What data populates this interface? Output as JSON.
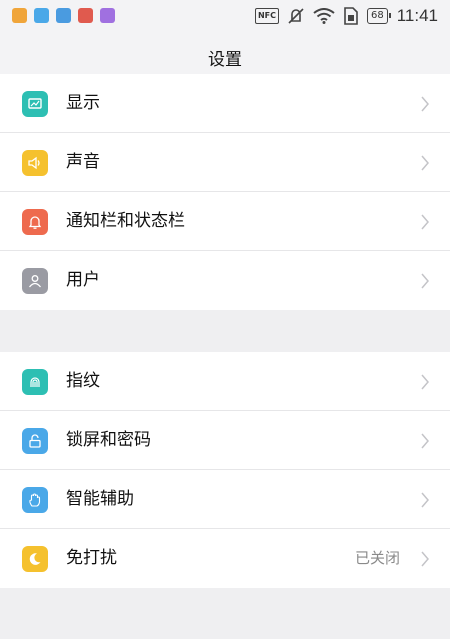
{
  "status_bar": {
    "time": "11:41",
    "battery": "68",
    "nfc": "NFC",
    "notification_apps": [
      {
        "icon": "browser-app-icon",
        "color": "#f0a53a"
      },
      {
        "icon": "message-app-icon",
        "color": "#4aa8e8"
      },
      {
        "icon": "photo-app-icon",
        "color": "#4a9be0"
      },
      {
        "icon": "shop-app-icon",
        "color": "#e05a4e"
      },
      {
        "icon": "video-app-icon",
        "color": "#a070e0"
      }
    ]
  },
  "header": {
    "title": "设置"
  },
  "groups": [
    {
      "items": [
        {
          "label": "显示",
          "icon": "display-icon",
          "color": "#2dbfb3"
        },
        {
          "label": "声音",
          "icon": "speaker-icon",
          "color": "#f5c12e"
        },
        {
          "label": "通知栏和状态栏",
          "icon": "bell-icon",
          "color": "#ee6a4e"
        },
        {
          "label": "用户",
          "icon": "user-icon",
          "color": "#9a9ba3"
        }
      ]
    },
    {
      "items": [
        {
          "label": "指纹",
          "icon": "fingerprint-icon",
          "color": "#2dbfb3"
        },
        {
          "label": "锁屏和密码",
          "icon": "lock-icon",
          "color": "#4aa8e8"
        },
        {
          "label": "智能辅助",
          "icon": "hand-icon",
          "color": "#4aa8e8"
        },
        {
          "label": "免打扰",
          "icon": "moon-icon",
          "color": "#f5c12e",
          "value": "已关闭"
        }
      ]
    }
  ]
}
